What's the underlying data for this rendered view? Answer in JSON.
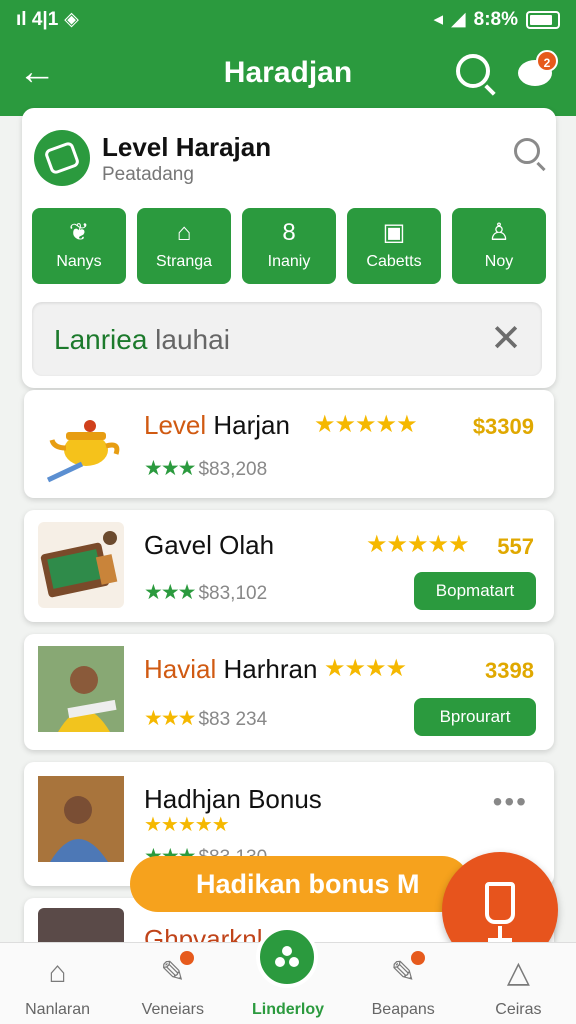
{
  "status": {
    "signal": "ıl 4|1",
    "right": "8:8%"
  },
  "header": {
    "title": "Haradjan",
    "notif_badge": "2"
  },
  "panel": {
    "title": "Level Harajan",
    "subtitle": "Peatadang"
  },
  "categories": [
    {
      "label": "Nanys",
      "icon": "leaf-icon",
      "glyph": "❦"
    },
    {
      "label": "Stranga",
      "icon": "bag-icon",
      "glyph": "⌂"
    },
    {
      "label": "Inaniy",
      "icon": "controller-icon",
      "glyph": "8"
    },
    {
      "label": "Cabetts",
      "icon": "calendar-icon",
      "glyph": "▣"
    },
    {
      "label": "Noy",
      "icon": "bulb-icon",
      "glyph": "♙"
    }
  ],
  "filter": {
    "green": "Lanriea",
    "rest": " lauhai"
  },
  "items": [
    {
      "title_o": "Level",
      "title_rest": " Harjan",
      "price": "$3309",
      "sub": "$83,208",
      "button": ""
    },
    {
      "title_o": "",
      "title_rest": "Gavel Olah",
      "price": "557",
      "sub": "$83,102",
      "button": "Bopmatart"
    },
    {
      "title_o": "Havial",
      "title_rest": " Harhran",
      "price": "3398",
      "sub": "$83 234",
      "button": "Bprourart"
    },
    {
      "title_o": "",
      "title_rest": "Hadhjan Bonus",
      "price": "",
      "sub": "$83 130",
      "button": ""
    },
    {
      "title_o": "",
      "title_rest": "Ghpvarknks",
      "price": "",
      "sub": "",
      "button": ""
    }
  ],
  "promo": {
    "text": "Hadikan bonus M"
  },
  "nav": [
    {
      "label": "Nanlaran",
      "icon": "home-icon",
      "glyph": "⌂"
    },
    {
      "label": "Veneiars",
      "icon": "edit-icon",
      "glyph": "✎"
    },
    {
      "label": "Linderloy",
      "icon": "group-icon",
      "glyph": ""
    },
    {
      "label": "Beapans",
      "icon": "tag-icon",
      "glyph": "✎"
    },
    {
      "label": "Ceiras",
      "icon": "hat-icon",
      "glyph": "△"
    }
  ],
  "colors": {
    "primary": "#2b9a3e",
    "accent": "#f6a21d",
    "fab": "#e7541d"
  }
}
